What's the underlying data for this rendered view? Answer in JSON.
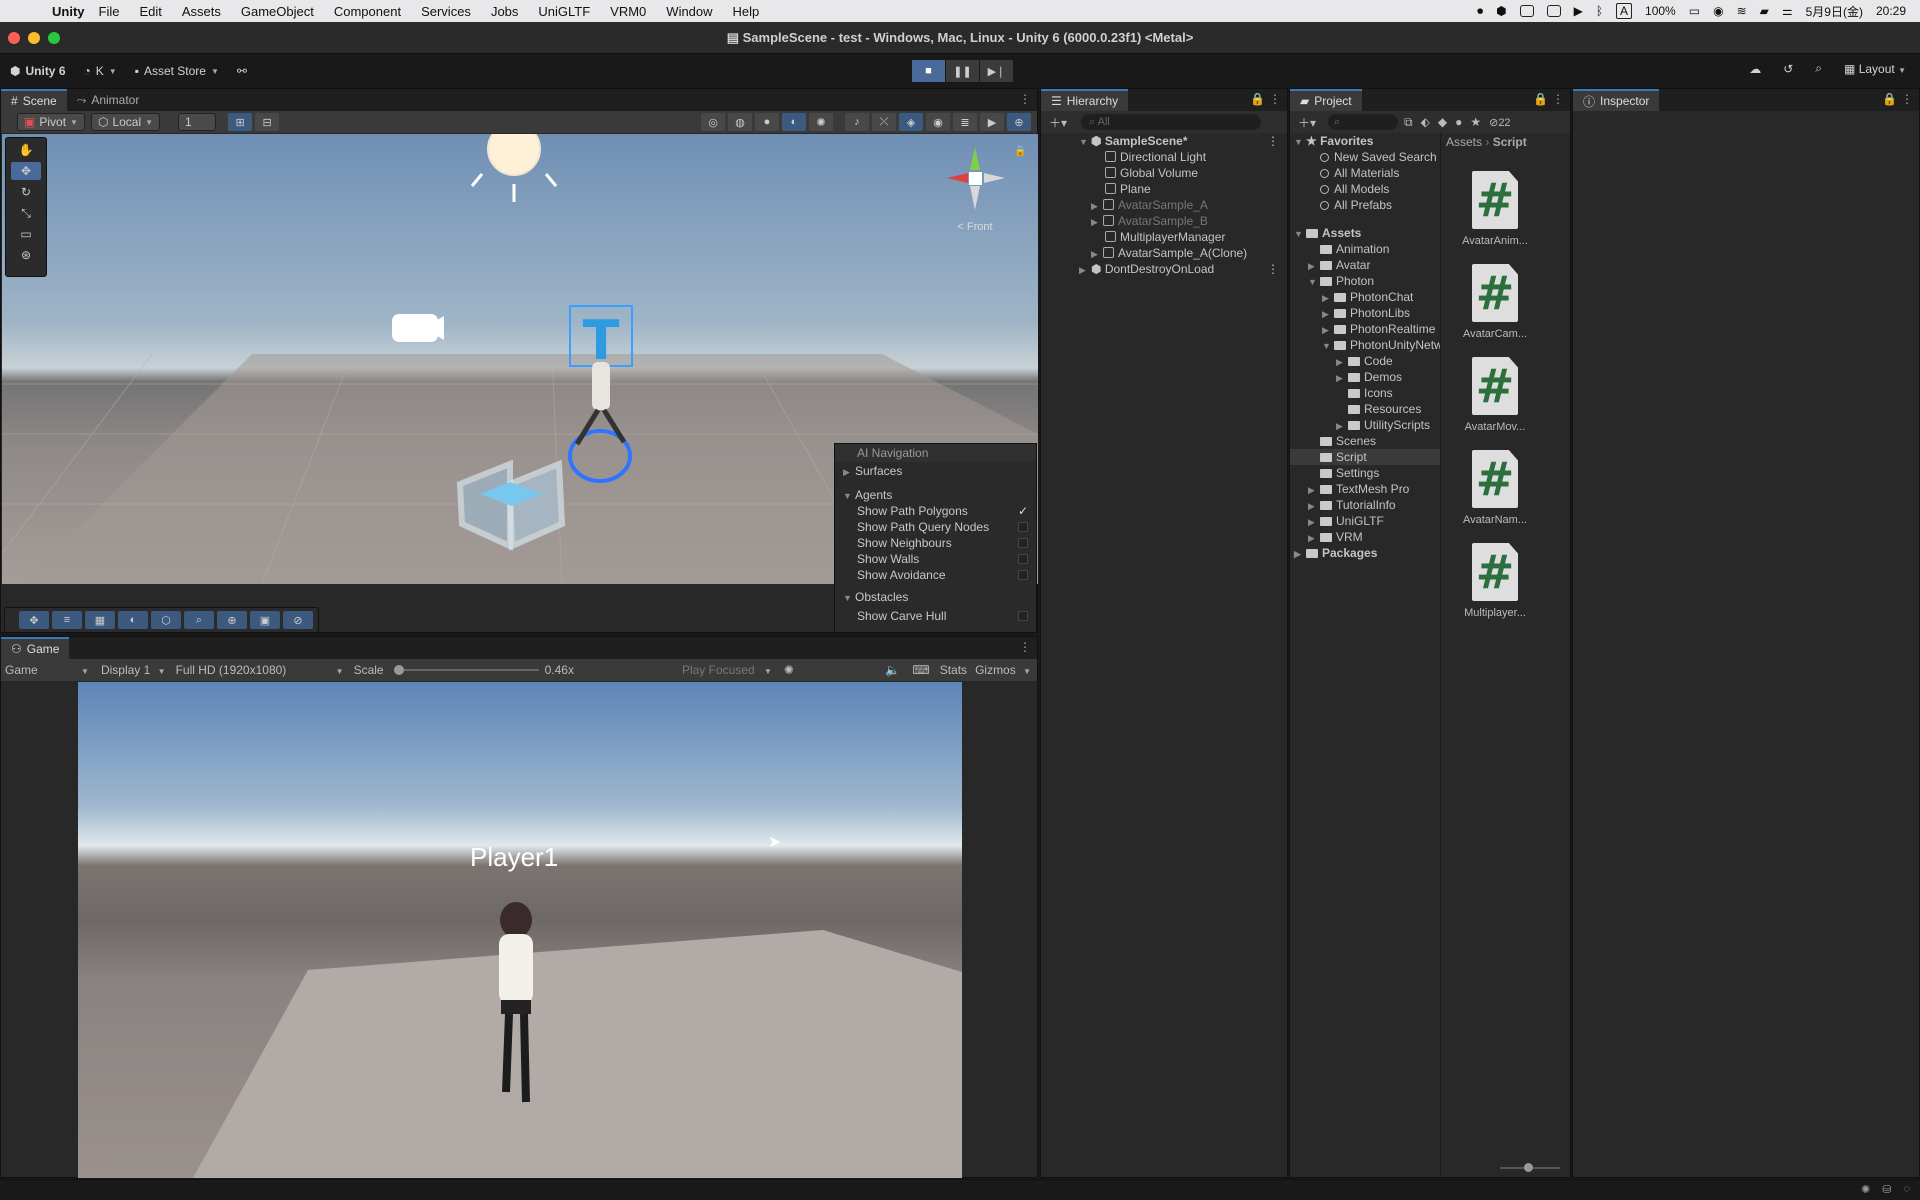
{
  "menubar": {
    "app": "Unity",
    "items": [
      "File",
      "Edit",
      "Assets",
      "GameObject",
      "Component",
      "Services",
      "Jobs",
      "UniGLTF",
      "VRM0",
      "Window",
      "Help"
    ],
    "status": {
      "input_source": "A",
      "battery": "100%",
      "date": "5月9日(金)",
      "time": "20:29"
    }
  },
  "window": {
    "title": "SampleScene - test - Windows, Mac, Linux - Unity 6 (6000.0.23f1) <Metal>"
  },
  "toolbar": {
    "unity_label": "Unity 6",
    "account": "K",
    "asset_store": "Asset Store",
    "layout": "Layout"
  },
  "scene_panel": {
    "tabs": [
      "Scene",
      "Animator"
    ],
    "pivot": "Pivot",
    "local": "Local",
    "grid_value": "1",
    "gizmo_view": "< Front"
  },
  "navigation_overlay": {
    "title": "AI Navigation",
    "surfaces": "Surfaces",
    "agents": "Agents",
    "agent_options": [
      {
        "label": "Show Path Polygons",
        "checked": true
      },
      {
        "label": "Show Path Query Nodes",
        "checked": false
      },
      {
        "label": "Show Neighbours",
        "checked": false
      },
      {
        "label": "Show Walls",
        "checked": false
      },
      {
        "label": "Show Avoidance",
        "checked": false
      }
    ],
    "obstacles": "Obstacles",
    "obstacle_options": [
      {
        "label": "Show Carve Hull",
        "checked": false
      }
    ]
  },
  "game_panel": {
    "tab": "Game",
    "mode": "Game",
    "display": "Display 1",
    "resolution": "Full HD (1920x1080)",
    "scale_label": "Scale",
    "scale_value": "0.46x",
    "play_focused": "Play Focused",
    "stats": "Stats",
    "gizmos": "Gizmos",
    "player_label": "Player1"
  },
  "hierarchy": {
    "tab": "Hierarchy",
    "search_placeholder": "All",
    "scene": "SampleScene*",
    "items": [
      "Directional Light",
      "Global Volume",
      "Plane",
      "AvatarSample_A",
      "AvatarSample_B",
      "MultiplayerManager",
      "AvatarSample_A(Clone)"
    ],
    "dont_destroy": "DontDestroyOnLoad"
  },
  "project": {
    "tab": "Project",
    "badge": "22",
    "favorites_label": "Favorites",
    "favorites": [
      "New Saved Search",
      "All Materials",
      "All Models",
      "All Prefabs"
    ],
    "assets_label": "Assets",
    "tree": [
      "Animation",
      "Avatar",
      "Photon",
      "PhotonChat",
      "PhotonLibs",
      "PhotonRealtime",
      "PhotonUnityNetworking",
      "Code",
      "Demos",
      "Icons",
      "Resources",
      "UtilityScripts",
      "Scenes",
      "Script",
      "Settings",
      "TextMesh Pro",
      "TutorialInfo",
      "UniGLTF",
      "VRM"
    ],
    "packages_label": "Packages",
    "breadcrumb": [
      "Assets",
      "Script"
    ],
    "files": [
      "AvatarAnim...",
      "AvatarCam...",
      "AvatarMov...",
      "AvatarNam...",
      "Multiplayer..."
    ]
  },
  "inspector": {
    "tab": "Inspector"
  }
}
